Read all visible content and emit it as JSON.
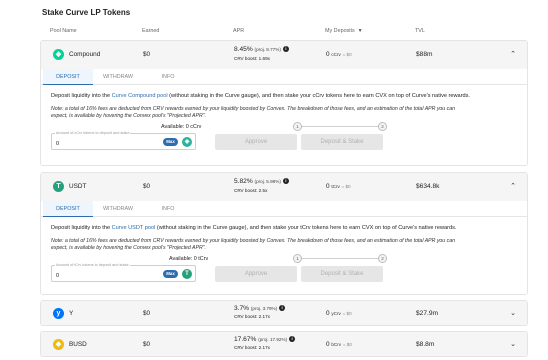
{
  "page": {
    "title": "Stake Curve LP Tokens"
  },
  "columns": {
    "pool_name": "Pool Name",
    "earned": "Earned",
    "apr": "APR",
    "my_deposits": "My Deposits",
    "tvl": "TVL"
  },
  "tabs": {
    "deposit": "DEPOSIT",
    "withdraw": "WITHDRAW",
    "info": "INFO"
  },
  "buttons": {
    "approve": "Approve",
    "deposit_stake": "Deposit & Stake",
    "max": "Max"
  },
  "pools": [
    {
      "name": "Compound",
      "earned": "$0",
      "apr": "8.45%",
      "apr_proj": "(proj. 8.77%)",
      "boost": "CRV boost: 1.69x",
      "deposit_amount": "0",
      "deposit_unit": "cCrv",
      "deposit_usd": "= $0",
      "tvl": "$88m",
      "icon_color": "#00d395",
      "icon_glyph": "◈",
      "expanded": true,
      "desc_pre": "Deposit liquidity into the ",
      "desc_link": "Curve Compound pool",
      "desc_post": " (without staking in the Curve gauge), and then stake your cCrv tokens here to earn CVX on top of Curve's native rewards.",
      "note_line1": "Note: a total of 16% fees are deducted from CRV rewards earned by your liquidity boosted by Convex. The breakdown of those fees, and an estimation of the total APR you can",
      "note_line2": "expect, is available by hovering the Convex pool's \"Projected APR\".",
      "input_label": "Amount of cCrv tokens to deposit and stake",
      "input_value": "0",
      "available": "Available: 0 cCrv",
      "token_icon_color": "#2fb39a"
    },
    {
      "name": "USDT",
      "earned": "$0",
      "apr": "5.82%",
      "apr_proj": "(proj. 5.98%)",
      "boost": "CRV boost: 2.5x",
      "deposit_amount": "0",
      "deposit_unit": "tCrv",
      "deposit_usd": "= $0",
      "tvl": "$634.8k",
      "icon_color": "#26a17b",
      "icon_glyph": "T",
      "expanded": true,
      "desc_pre": "Deposit liquidity into the ",
      "desc_link": "Curve USDT pool",
      "desc_post": " (without staking in the Curve gauge), and then stake your tCrv tokens here to earn CVX on top of Curve's native rewards.",
      "note_line1": "Note: a total of 16% fees are deducted from CRV rewards earned by your liquidity boosted by Convex. The breakdown of those fees, and an estimation of the total APR you can",
      "note_line2": "expect, is available by hovering the Convex pool's \"Projected APR\".",
      "input_label": "Amount of tCrv tokens to deposit and stake",
      "input_value": "0",
      "available": "Available: 0 tCrv",
      "token_icon_color": "#26a17b"
    },
    {
      "name": "Y",
      "earned": "$0",
      "apr": "3.7%",
      "apr_proj": "(proj. 3.79%)",
      "boost": "CRV boost: 2.17x",
      "deposit_amount": "0",
      "deposit_unit": "yCrv",
      "deposit_usd": "= $0",
      "tvl": "$27.9m",
      "icon_color": "#0074fa",
      "icon_glyph": "y",
      "expanded": false
    },
    {
      "name": "BUSD",
      "earned": "$0",
      "apr": "17.67%",
      "apr_proj": "(proj. 17.92%)",
      "boost": "CRV boost: 2.17x",
      "deposit_amount": "0",
      "deposit_unit": "bCrv",
      "deposit_usd": "= $0",
      "tvl": "$8.8m",
      "icon_color": "#f0b90b",
      "icon_glyph": "◆",
      "expanded": false
    }
  ]
}
